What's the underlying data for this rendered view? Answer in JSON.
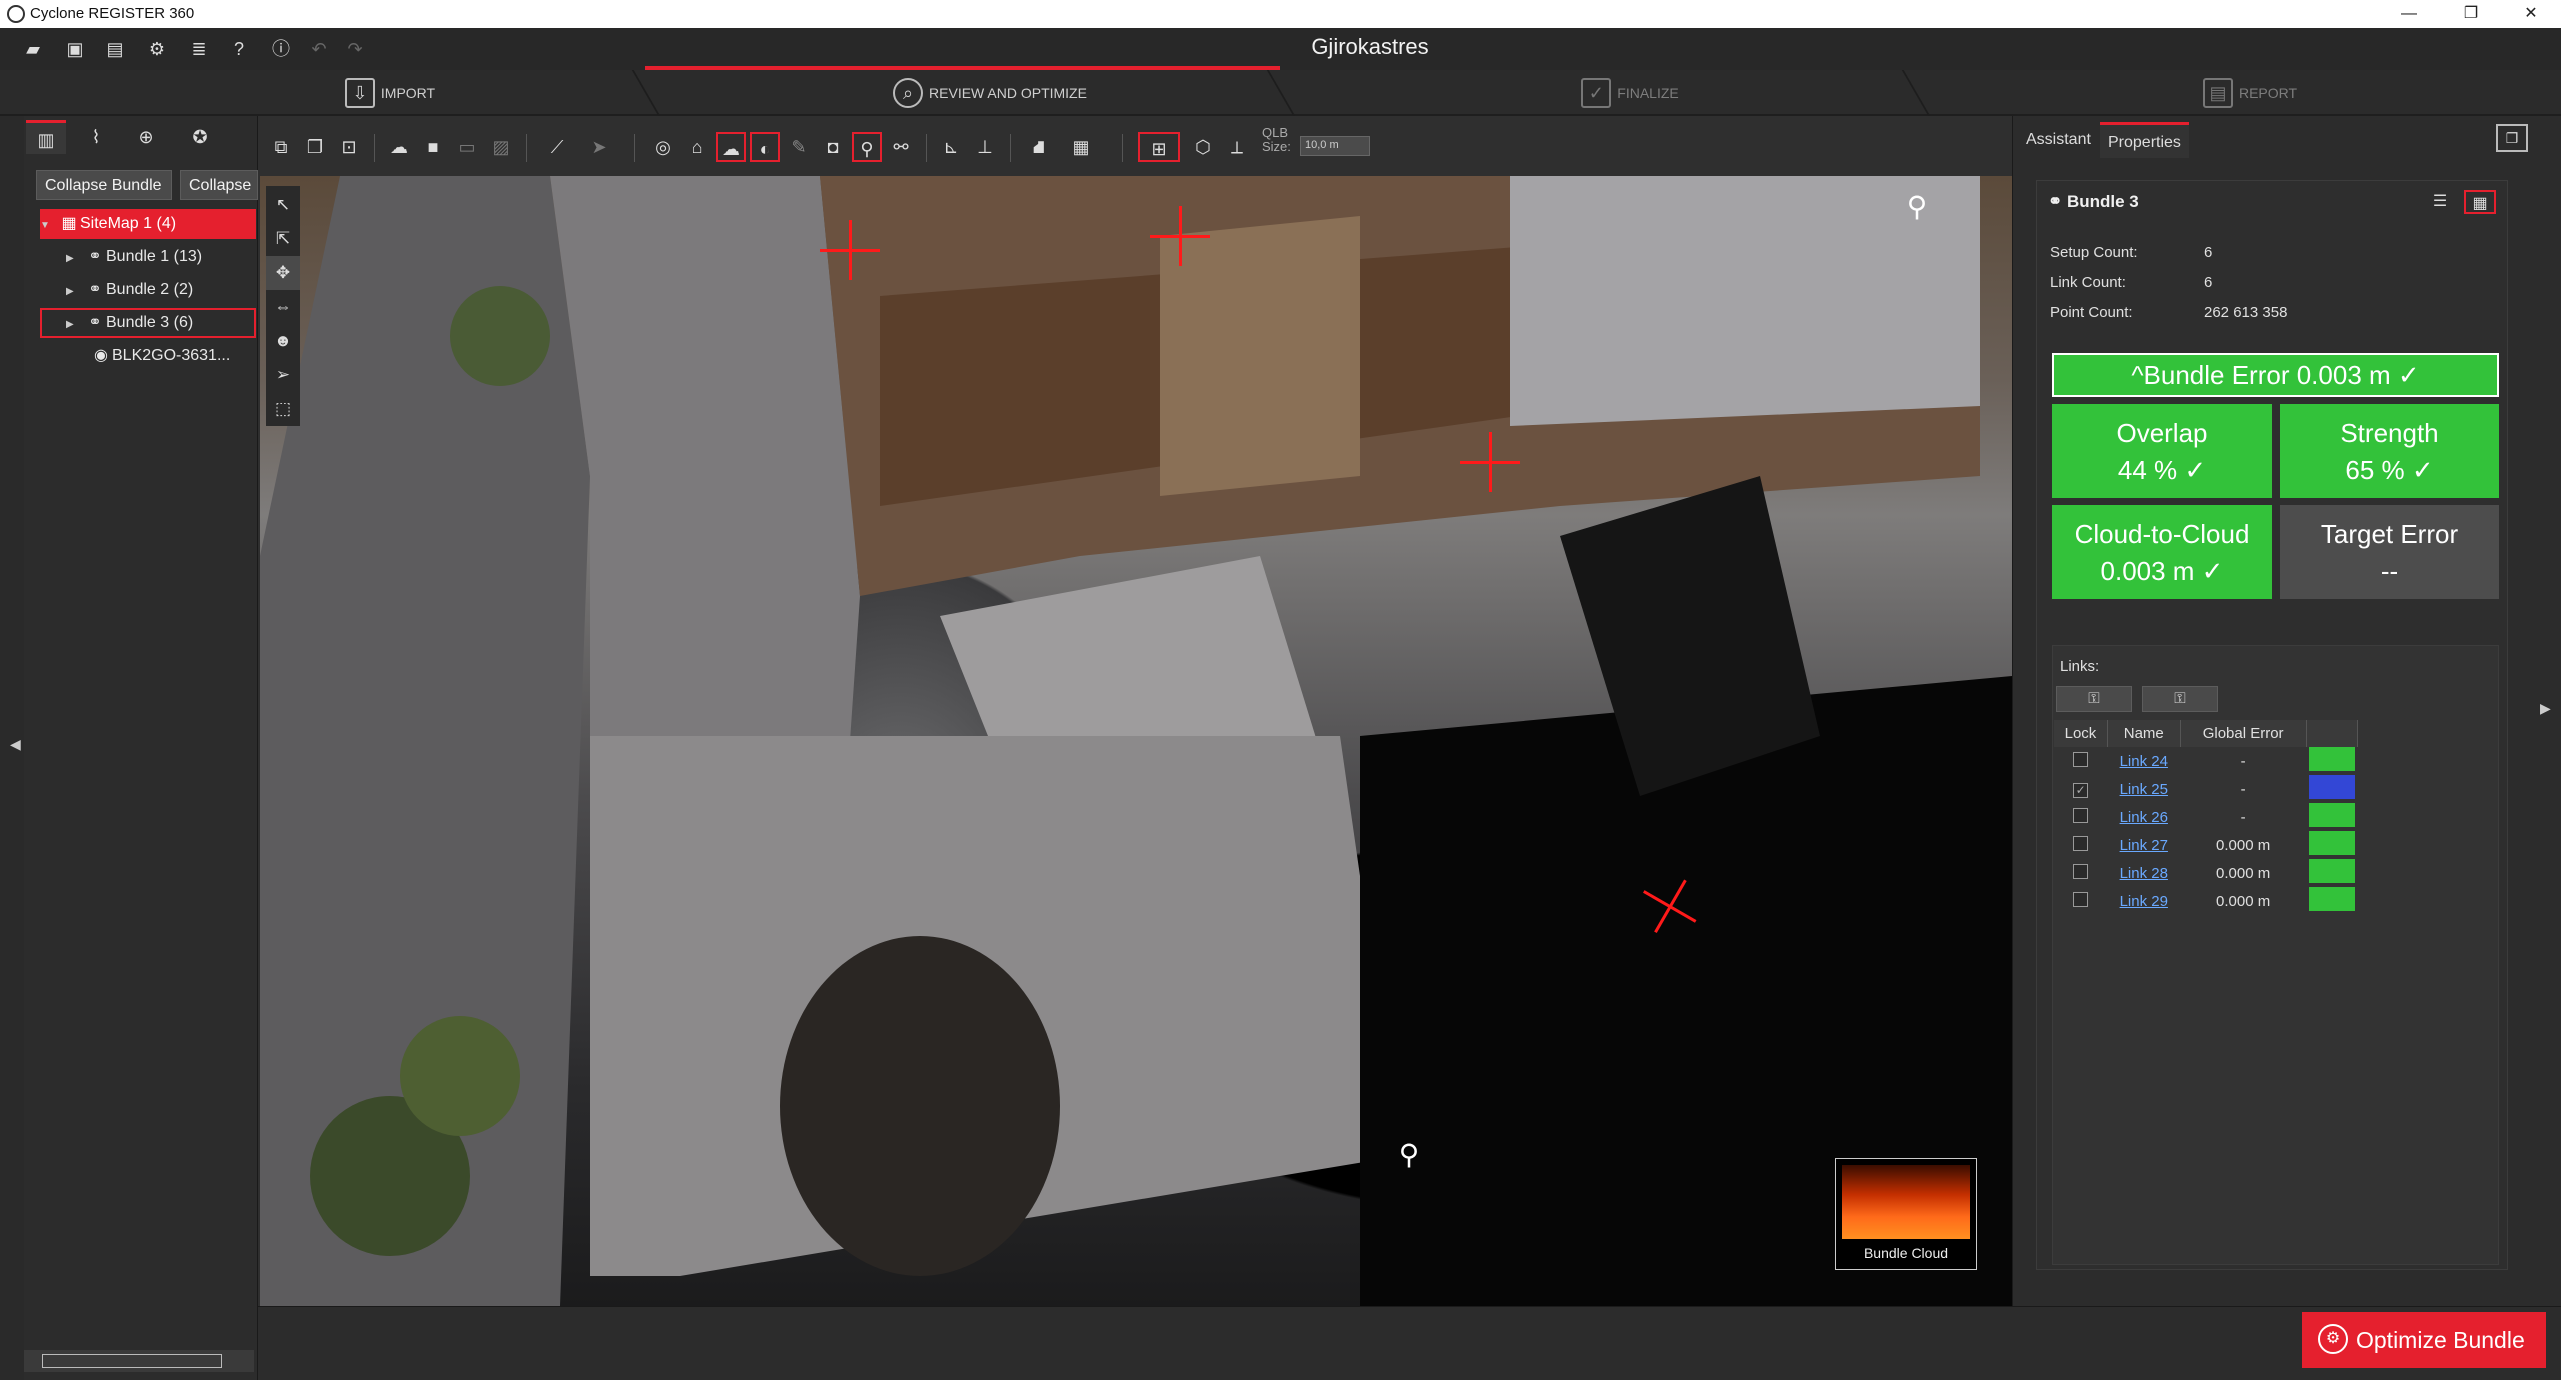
{
  "window": {
    "title": "Cyclone REGISTER 360",
    "controls": [
      "—",
      "❐",
      "✕"
    ]
  },
  "project": {
    "title": "Gjirokastres"
  },
  "workflow": {
    "steps": [
      {
        "label": "IMPORT",
        "icon": "import-icon"
      },
      {
        "label": "REVIEW AND OPTIMIZE",
        "icon": "review-icon"
      },
      {
        "label": "FINALIZE",
        "icon": "finalize-icon"
      },
      {
        "label": "REPORT",
        "icon": "report-icon"
      }
    ],
    "active_index": 1
  },
  "left_panel": {
    "buttons": {
      "collapse_bundle": "Collapse Bundle",
      "collapse": "Collapse"
    },
    "tree": [
      {
        "label": "SiteMap 1 (4)",
        "type": "sitemap",
        "selected": true
      },
      {
        "label": "Bundle 1 (13)",
        "type": "bundle"
      },
      {
        "label": "Bundle 2 (2)",
        "type": "bundle"
      },
      {
        "label": "Bundle 3 (6)",
        "type": "bundle",
        "outlined": true
      },
      {
        "label": "BLK2GO-3631...",
        "type": "setup"
      }
    ]
  },
  "viewer_toolbar": {
    "qlb_label": "QLB\nSize:",
    "qlb_value": "10,0 m"
  },
  "viewer": {
    "bundle_cloud_label": "Bundle Cloud"
  },
  "right_panel": {
    "tabs": [
      "Assistant",
      "Properties"
    ],
    "active_tab": "Properties",
    "bundle": {
      "name": "Bundle 3",
      "setup_count_label": "Setup Count:",
      "setup_count": "6",
      "link_count_label": "Link Count:",
      "link_count": "6",
      "point_count_label": "Point Count:",
      "point_count": "262 613 358"
    },
    "metrics": {
      "bundle_error": "^Bundle Error 0.003 m  ✓",
      "overlap_label": "Overlap",
      "overlap_value": "44 %  ✓",
      "strength_label": "Strength",
      "strength_value": "65 %  ✓",
      "c2c_label": "Cloud-to-Cloud",
      "c2c_value": "0.003 m  ✓",
      "target_label": "Target Error",
      "target_value": "--"
    },
    "links": {
      "label": "Links:",
      "columns": [
        "Lock",
        "Name",
        "Global Error"
      ],
      "rows": [
        {
          "lock": "",
          "name": "Link 24",
          "error": "-",
          "color": "#33c23a"
        },
        {
          "lock": "✓",
          "name": "Link 25",
          "error": "-",
          "color": "#3347d6"
        },
        {
          "lock": "",
          "name": "Link 26",
          "error": "-",
          "color": "#33c23a"
        },
        {
          "lock": "",
          "name": "Link 27",
          "error": "0.000 m",
          "color": "#33c23a"
        },
        {
          "lock": "",
          "name": "Link 28",
          "error": "0.000 m",
          "color": "#33c23a"
        },
        {
          "lock": "",
          "name": "Link 29",
          "error": "0.000 m",
          "color": "#33c23a"
        }
      ]
    }
  },
  "bottom": {
    "optimize_label": "Optimize Bundle"
  },
  "colors": {
    "accent": "#e5202e",
    "good": "#33c23a",
    "neutral": "#4d4d4d"
  }
}
